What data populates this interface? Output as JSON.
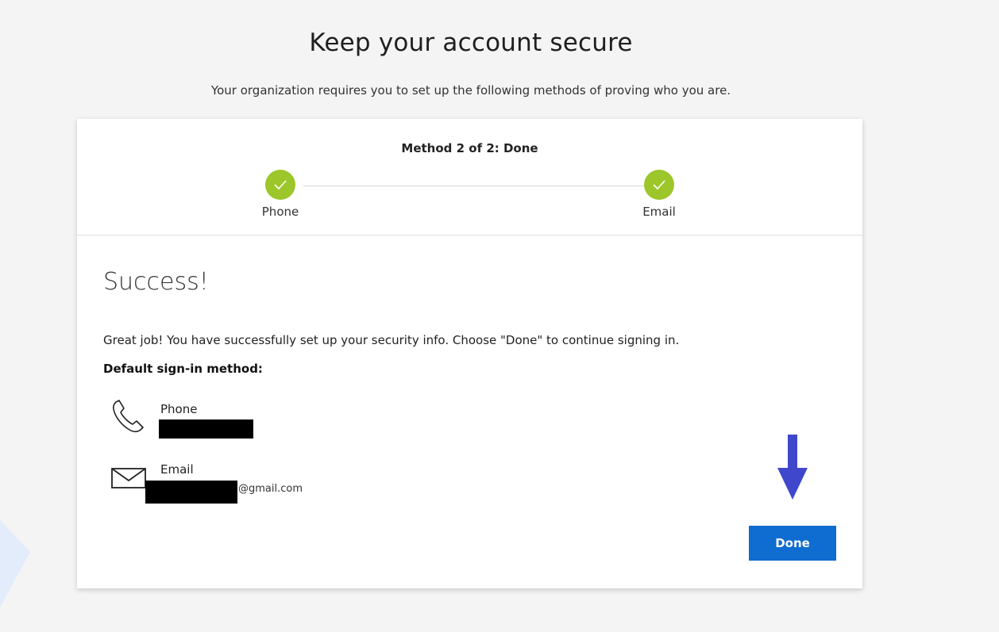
{
  "page": {
    "title": "Keep your account secure",
    "subtitle": "Your organization requires you to set up the following methods of proving who you are."
  },
  "progress": {
    "title": "Method 2 of 2: Done",
    "steps": [
      {
        "label": "Phone",
        "status": "complete"
      },
      {
        "label": "Email",
        "status": "complete"
      }
    ],
    "complete_color": "#9cc62a"
  },
  "success": {
    "title": "Success!",
    "message": "Great job! You have successfully set up your security info. Choose \"Done\" to continue signing in.",
    "default_label": "Default sign-in method:"
  },
  "methods": {
    "phone": {
      "name": "Phone",
      "icon": "phone-icon"
    },
    "email": {
      "name": "Email",
      "icon": "mail-icon",
      "domain": "@gmail.com"
    }
  },
  "actions": {
    "done_label": "Done",
    "accent_color": "#0f6cd0",
    "arrow_color": "#3f48cc"
  }
}
